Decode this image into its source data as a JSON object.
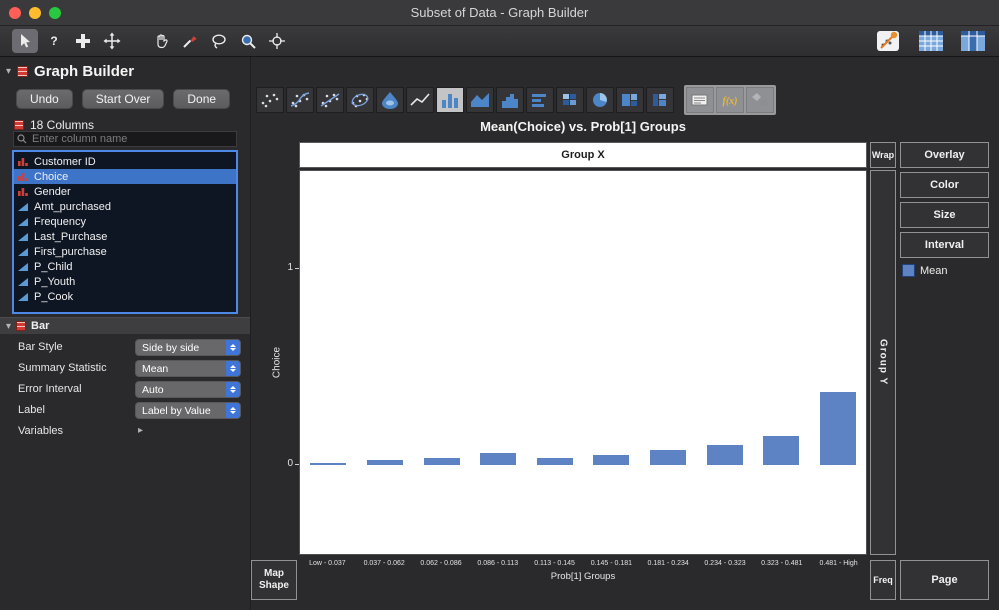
{
  "window": {
    "title": "Subset of Data - Graph Builder"
  },
  "toolbar": {
    "tools": [
      {
        "name": "arrow",
        "selected": true
      },
      {
        "name": "help"
      },
      {
        "name": "fat-plus"
      },
      {
        "name": "move"
      },
      {
        "name": "grabber",
        "group_start": true
      },
      {
        "name": "brush"
      },
      {
        "name": "lasso"
      },
      {
        "name": "magnifier"
      },
      {
        "name": "crosshair"
      }
    ],
    "right_tools": [
      {
        "name": "graph-launch"
      },
      {
        "name": "data-table"
      },
      {
        "name": "columns-view"
      }
    ]
  },
  "panel": {
    "title": "Graph Builder",
    "undo_label": "Undo",
    "start_over_label": "Start Over",
    "done_label": "Done",
    "columns_header": "18 Columns",
    "search_placeholder": "Enter column name",
    "columns": [
      {
        "name": "Customer ID",
        "type": "nominal"
      },
      {
        "name": "Choice",
        "type": "nominal",
        "selected": true
      },
      {
        "name": "Gender",
        "type": "nominal"
      },
      {
        "name": "Amt_purchased",
        "type": "continuous"
      },
      {
        "name": "Frequency",
        "type": "continuous"
      },
      {
        "name": "Last_Purchase",
        "type": "continuous"
      },
      {
        "name": "First_purchase",
        "type": "continuous"
      },
      {
        "name": "P_Child",
        "type": "continuous"
      },
      {
        "name": "P_Youth",
        "type": "continuous"
      },
      {
        "name": "P_Cook",
        "type": "continuous"
      }
    ],
    "bar_section": {
      "title": "Bar",
      "properties": [
        {
          "label": "Bar Style",
          "value": "Side by side"
        },
        {
          "label": "Summary Statistic",
          "value": "Mean"
        },
        {
          "label": "Error Interval",
          "value": "Auto"
        },
        {
          "label": "Label",
          "value": "Label by Value"
        }
      ],
      "variables_label": "Variables"
    }
  },
  "palette": {
    "icons": [
      "scatter",
      "smoother",
      "line-of-fit",
      "ellipse",
      "contour",
      "line",
      "bar",
      "area",
      "histogram",
      "bar-h",
      "heatmap",
      "pie",
      "treemap",
      "mosaic",
      "caption-box",
      "formula",
      "map-shapes"
    ],
    "selected": "bar"
  },
  "graph": {
    "title": "Mean(Choice) vs. Prob[1] Groups",
    "zones": {
      "group_x": "Group X",
      "group_y": "Group Y",
      "wrap": "Wrap",
      "overlay": "Overlay",
      "color": "Color",
      "size": "Size",
      "interval": "Interval",
      "freq": "Freq",
      "page": "Page",
      "map_shape": "Map Shape"
    },
    "legend": {
      "label": "Mean",
      "color": "#5d83c4"
    }
  },
  "chart_data": {
    "type": "bar",
    "title": "Mean(Choice) vs. Prob[1] Groups",
    "categories": [
      "Low - 0.037",
      "0.037 - 0.062",
      "0.062 - 0.086",
      "0.086 - 0.113",
      "0.113 - 0.145",
      "0.145 - 0.181",
      "0.181 - 0.234",
      "0.234 - 0.323",
      "0.323 - 0.481",
      "0.481 - High"
    ],
    "values": [
      0.01,
      0.026,
      0.036,
      0.061,
      0.036,
      0.051,
      0.077,
      0.102,
      0.148,
      0.372
    ],
    "xlabel": "Prob[1] Groups",
    "ylabel": "Choice",
    "yticks": [
      0,
      1
    ],
    "ylim": [
      -0.46,
      1.5
    ],
    "grid": false,
    "legend_entries": [
      "Mean"
    ],
    "bar_color": "#5d83c4"
  }
}
